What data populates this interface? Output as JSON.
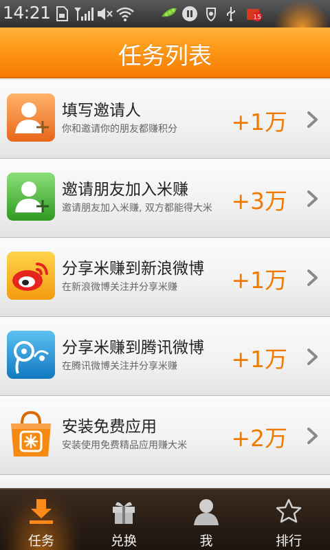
{
  "status_bar": {
    "time": "14:21",
    "notification_count": "15",
    "icons": [
      "sd-card-icon",
      "signal-icon",
      "mute-icon",
      "wifi-icon",
      "peapod-icon",
      "pause-icon",
      "usb-debug-icon",
      "usb-icon",
      "store-icon"
    ]
  },
  "header": {
    "title": "任务列表"
  },
  "tasks": [
    {
      "icon": "invite-contact-icon",
      "title": "填写邀请人",
      "subtitle": "你和邀请你的朋友都赚积分",
      "reward": "+1万"
    },
    {
      "icon": "invite-friend-icon",
      "title": "邀请朋友加入米赚",
      "subtitle": "邀请朋友加入米赚, 双方都能得大米",
      "reward": "+3万"
    },
    {
      "icon": "sina-weibo-icon",
      "title": "分享米赚到新浪微博",
      "subtitle": "在新浪微博关注并分享米赚",
      "reward": "+1万"
    },
    {
      "icon": "tencent-weibo-icon",
      "title": "分享米赚到腾讯微博",
      "subtitle": "在腾讯微博关注并分享米赚",
      "reward": "+1万"
    },
    {
      "icon": "shopping-bag-icon",
      "title": "安装免费应用",
      "subtitle": "安装使用免费精品应用赚大米",
      "reward": "+2万"
    }
  ],
  "tabs": [
    {
      "label": "任务",
      "icon": "download-icon",
      "active": true
    },
    {
      "label": "兑换",
      "icon": "gift-icon",
      "active": false
    },
    {
      "label": "我",
      "icon": "person-icon",
      "active": false
    },
    {
      "label": "排行",
      "icon": "star-icon",
      "active": false
    }
  ],
  "colors": {
    "accent": "#f57b00",
    "reward": "#f07a00",
    "tab_bar": "#2a1e15"
  }
}
